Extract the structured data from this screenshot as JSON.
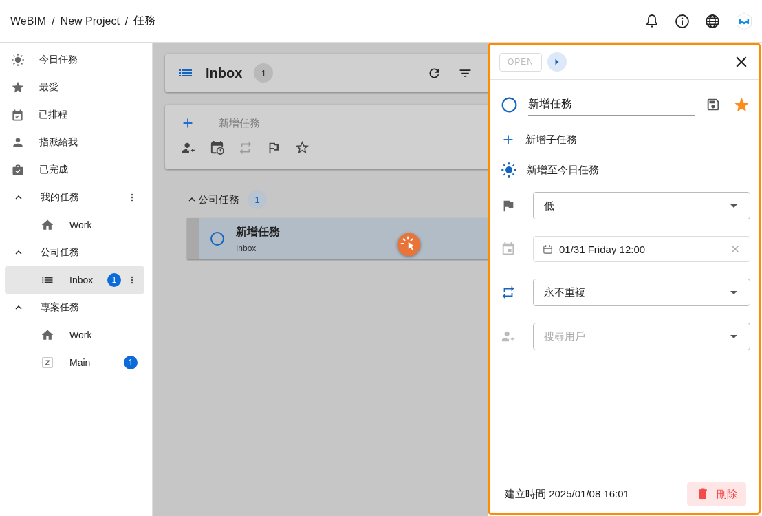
{
  "header": {
    "breadcrumb": [
      {
        "kind": "link",
        "text": "WeBIM"
      },
      {
        "kind": "separator",
        "text": "/"
      },
      {
        "kind": "link",
        "text": "New Project"
      },
      {
        "kind": "separator",
        "text": "/"
      },
      {
        "kind": "link",
        "text": "任務"
      }
    ]
  },
  "sidebar": {
    "items": [
      {
        "kind": "today",
        "label": "今日任務",
        "selected": false
      },
      {
        "kind": "favorite",
        "label": "最愛",
        "selected": false
      },
      {
        "kind": "scheduled",
        "label": "已排程",
        "selected": false
      },
      {
        "kind": "assigned",
        "label": "指派給我",
        "selected": false
      },
      {
        "kind": "completed",
        "label": "已完成",
        "selected": false
      },
      {
        "kind": "group",
        "label": "我的任務",
        "selected": false,
        "expanded": true,
        "menu": true,
        "children": [
          {
            "kind": "home",
            "label": "Work",
            "selected": false,
            "menu": false
          }
        ]
      },
      {
        "kind": "group",
        "label": "公司任務",
        "selected": false,
        "expanded": true,
        "menu": false,
        "children": [
          {
            "kind": "list",
            "label": "Inbox",
            "badge": "1",
            "selected": true,
            "menu": true
          }
        ]
      },
      {
        "kind": "group",
        "label": "專案任務",
        "selected": false,
        "expanded": true,
        "menu": false,
        "children": [
          {
            "kind": "home",
            "label": "Work",
            "selected": false,
            "menu": false
          },
          {
            "kind": "project",
            "label": "Main",
            "badge": "1",
            "selected": false,
            "menu": false
          }
        ]
      }
    ]
  },
  "main": {
    "title": "Inbox",
    "count": "1",
    "quick_add": {
      "placeholder": "新增任務"
    },
    "sections": [
      {
        "title": "公司任務",
        "count": "1",
        "expanded": true,
        "tasks": [
          {
            "title": "新增任務",
            "list": "Inbox",
            "selected": true,
            "completed": false
          }
        ]
      }
    ]
  },
  "detail": {
    "status": {
      "label": "OPEN",
      "disabled": true
    },
    "title": "新增任務",
    "completed": false,
    "starred": true,
    "add_subtask": "新增子任務",
    "add_to_today": {
      "label": "新增至今日任務",
      "on": true
    },
    "priority": {
      "value": "低"
    },
    "due": {
      "value": "01/31 Friday 12:00"
    },
    "repeat": {
      "value": "永不重複",
      "on": true
    },
    "assignee": {
      "placeholder": "搜尋用戶"
    },
    "created": "建立時間 2025/01/08 16:01",
    "delete": "刪除"
  }
}
